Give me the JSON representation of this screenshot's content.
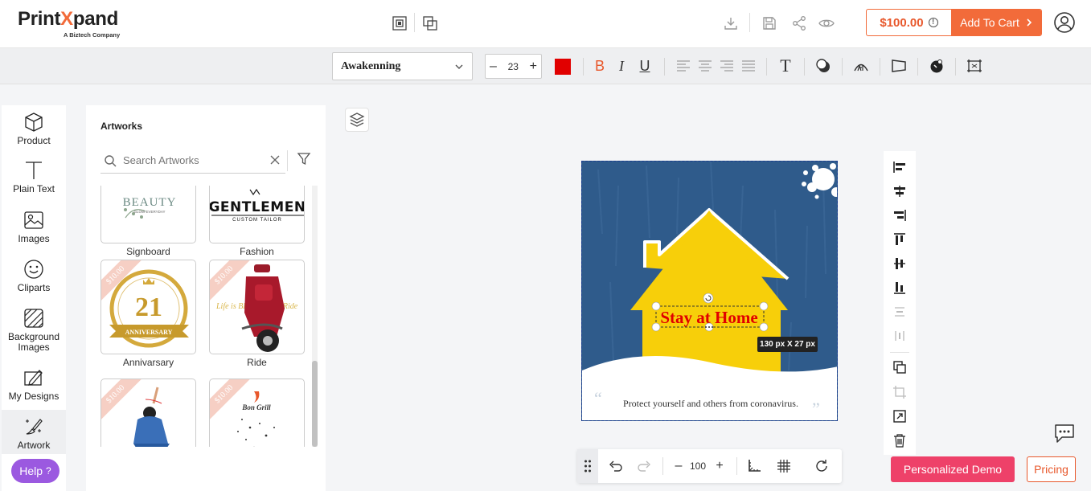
{
  "header": {
    "brand_part1": "Print",
    "brand_x": "X",
    "brand_part2": "pand",
    "brand_tagline": "A Biztech Company",
    "price": "$100.00",
    "price_info_icon": "!",
    "add_to_cart": "Add To Cart",
    "icons": [
      "layer-front-icon",
      "layer-back-icon",
      "download-icon",
      "save-icon",
      "share-icon",
      "preview-eye-icon",
      "user-avatar-icon"
    ]
  },
  "toolbar": {
    "font_family": "Awakenning",
    "font_size": "23",
    "minus": "–",
    "plus": "+",
    "text_color": "#e10000",
    "bold": "B",
    "italic": "I",
    "underline": "U",
    "text_icon": "T"
  },
  "sidebar": {
    "items": [
      {
        "label": "Product",
        "icon": "cube-icon"
      },
      {
        "label": "Plain Text",
        "icon": "text-icon"
      },
      {
        "label": "Images",
        "icon": "image-icon"
      },
      {
        "label": "Cliparts",
        "icon": "smiley-icon"
      },
      {
        "label": "Background Images",
        "icon": "background-icon"
      },
      {
        "label": "My Designs",
        "icon": "my-designs-icon"
      },
      {
        "label": "Artwork",
        "icon": "artwork-icon"
      }
    ],
    "active": "Artwork",
    "help": "Help",
    "help_icon": "?"
  },
  "artworks_panel": {
    "title": "Artworks",
    "search_placeholder": "Search Artworks",
    "items": [
      {
        "label": "Signboard",
        "art_text": "BEAUTY",
        "art_sub": "GLOW EVERYDAY",
        "price": ""
      },
      {
        "label": "Fashion",
        "art_text": "GENTLEMEN",
        "art_sub": "CUSTOM TAILOR",
        "price": ""
      },
      {
        "label": "Annivarsary",
        "art_text": "21",
        "art_sub": "ANNIVERSARY",
        "price": "$10.00"
      },
      {
        "label": "Ride",
        "art_text": "Life is BEAUTIFUL Ride",
        "art_sub": "",
        "price": "$10.00"
      },
      {
        "label": "",
        "art_text": "",
        "art_sub": "",
        "price": "$10.00"
      },
      {
        "label": "",
        "art_text": "Bon Grill",
        "art_sub": "",
        "price": "$10.00"
      }
    ]
  },
  "canvas": {
    "headline": "Stay at Home",
    "headline_color": "#e10000",
    "quote": "Protect yourself and others from coronavirus.",
    "size_tooltip": "130 px X 27 px",
    "background_color": "#2f5b8b",
    "house_color": "#f7cf0a"
  },
  "bottom_bar": {
    "zoom": "100",
    "minus": "–",
    "plus": "+"
  },
  "actions": {
    "personalized_demo": "Personalized Demo",
    "pricing": "Pricing"
  }
}
